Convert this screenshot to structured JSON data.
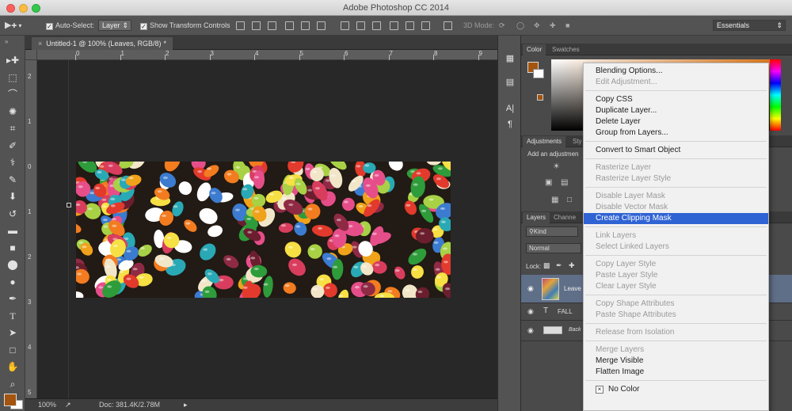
{
  "window": {
    "title": "Adobe Photoshop CC 2014"
  },
  "options_bar": {
    "auto_select_label": "Auto-Select:",
    "auto_select_value": "Layer",
    "show_transform_label": "Show Transform Controls",
    "mode_3d_label": "3D Mode:",
    "workspace": "Essentials"
  },
  "document": {
    "tab_title": "Untitled-1 @ 100% (Leaves, RGB/8)",
    "modified_mark": "*"
  },
  "rulers": {
    "h_ticks": [
      "0",
      "1",
      "2",
      "3",
      "4",
      "5",
      "6",
      "7",
      "8",
      "9"
    ],
    "v_ticks": [
      "2",
      "1",
      "0",
      "1",
      "2",
      "3",
      "4",
      "5"
    ]
  },
  "status": {
    "zoom": "100%",
    "doc_size": "Doc: 381.4K/2.78M"
  },
  "panels": {
    "color_tabs": [
      "Color",
      "Swatches"
    ],
    "adjustments_tabs": [
      "Adjustments",
      "Sty"
    ],
    "adjustments_hint": "Add an adjustmen",
    "layers_tabs": [
      "Layers",
      "Channe"
    ],
    "kind_label": "Kind",
    "blend_mode": "Normal",
    "lock_label": "Lock:",
    "layers": [
      {
        "name": "Leave"
      },
      {
        "name": "FALL"
      },
      {
        "name": "Back"
      }
    ]
  },
  "context_menu": {
    "items": [
      {
        "label": "Blending Options...",
        "enabled": true
      },
      {
        "label": "Edit Adjustment...",
        "enabled": false
      },
      {
        "sep": true
      },
      {
        "label": "Copy CSS",
        "enabled": true
      },
      {
        "label": "Duplicate Layer...",
        "enabled": true
      },
      {
        "label": "Delete Layer",
        "enabled": true
      },
      {
        "label": "Group from Layers...",
        "enabled": true
      },
      {
        "sep": true
      },
      {
        "label": "Convert to Smart Object",
        "enabled": true
      },
      {
        "sep": true
      },
      {
        "label": "Rasterize Layer",
        "enabled": false
      },
      {
        "label": "Rasterize Layer Style",
        "enabled": false
      },
      {
        "sep": true
      },
      {
        "label": "Disable Layer Mask",
        "enabled": false
      },
      {
        "label": "Disable Vector Mask",
        "enabled": false
      },
      {
        "label": "Create Clipping Mask",
        "enabled": true,
        "highlighted": true
      },
      {
        "sep": true
      },
      {
        "label": "Link Layers",
        "enabled": false
      },
      {
        "label": "Select Linked Layers",
        "enabled": false
      },
      {
        "sep": true
      },
      {
        "label": "Copy Layer Style",
        "enabled": false
      },
      {
        "label": "Paste Layer Style",
        "enabled": false
      },
      {
        "label": "Clear Layer Style",
        "enabled": false
      },
      {
        "sep": true
      },
      {
        "label": "Copy Shape Attributes",
        "enabled": false
      },
      {
        "label": "Paste Shape Attributes",
        "enabled": false
      },
      {
        "sep": true
      },
      {
        "label": "Release from Isolation",
        "enabled": false
      },
      {
        "sep": true
      },
      {
        "label": "Merge Layers",
        "enabled": false
      },
      {
        "label": "Merge Visible",
        "enabled": true
      },
      {
        "label": "Flatten Image",
        "enabled": true
      },
      {
        "sep": true
      },
      {
        "label": "No Color",
        "enabled": true,
        "checked": true
      }
    ]
  },
  "colors": {
    "foreground": "#a3540f",
    "background": "#ffffff",
    "menu_highlight": "#2f63d4",
    "canvas_bg": "#282828"
  },
  "icons": {
    "tools": [
      "move-tool-icon",
      "marquee-tool-icon",
      "lasso-tool-icon",
      "quick-select-tool-icon",
      "crop-tool-icon",
      "eyedropper-tool-icon",
      "healing-brush-icon",
      "brush-tool-icon",
      "clone-stamp-icon",
      "history-brush-icon",
      "eraser-tool-icon",
      "gradient-tool-icon",
      "blur-tool-icon",
      "dodge-tool-icon",
      "pen-tool-icon",
      "type-tool-icon",
      "path-select-icon",
      "rectangle-tool-icon",
      "hand-tool-icon",
      "zoom-tool-icon"
    ]
  }
}
